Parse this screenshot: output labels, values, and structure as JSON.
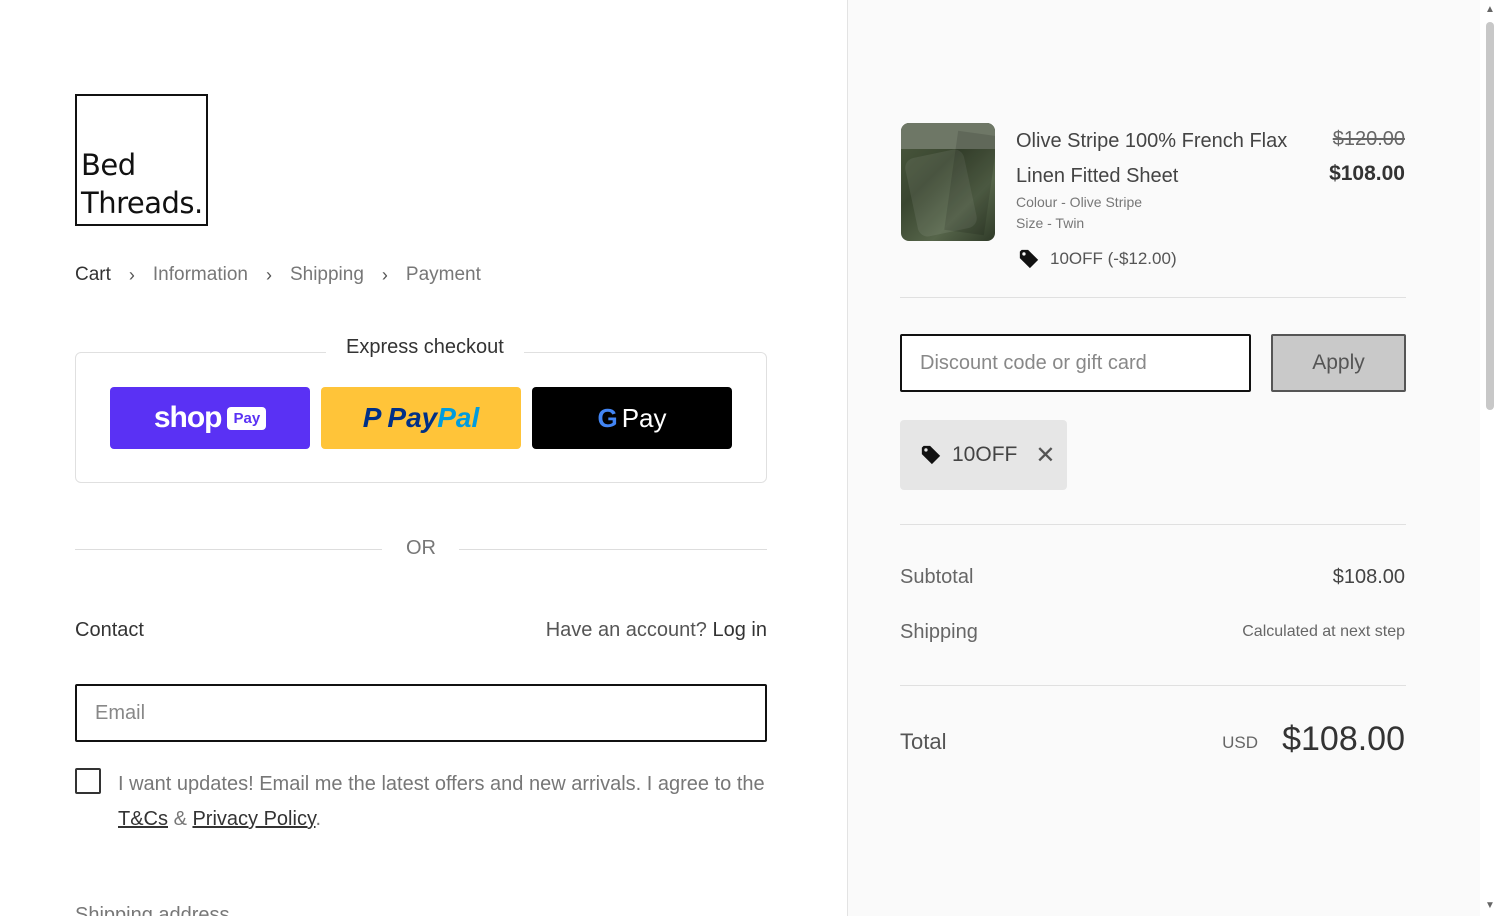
{
  "brand": {
    "line1": "Bed",
    "line2": "Threads."
  },
  "breadcrumb": [
    {
      "label": "Cart",
      "active": true
    },
    {
      "label": "Information",
      "active": false
    },
    {
      "label": "Shipping",
      "active": false
    },
    {
      "label": "Payment",
      "active": false
    }
  ],
  "express": {
    "title": "Express checkout",
    "shop_pay": {
      "word": "shop",
      "tag": "Pay"
    },
    "paypal": {
      "p": "P",
      "word1": "Pay",
      "word2": "Pal"
    },
    "gpay": {
      "g": "G",
      "word": "Pay"
    }
  },
  "divider": {
    "or": "OR"
  },
  "contact": {
    "label": "Contact",
    "account_prompt": "Have an account?",
    "login": "Log in",
    "email_placeholder": "Email",
    "consent_text": "I want updates! Email me the latest offers and new arrivals. I agree to the",
    "tcs": "T&Cs",
    "amp": "&",
    "privacy": "Privacy Policy",
    "period": "."
  },
  "next_section_peek": "Shipping address",
  "product": {
    "title": "Olive Stripe 100% French Flax Linen Fitted Sheet",
    "colour": "Colour - Olive Stripe",
    "size": "Size - Twin",
    "discount": "10OFF (-$12.00)",
    "old_price": "$120.00",
    "new_price": "$108.00"
  },
  "discount_form": {
    "placeholder": "Discount code or gift card",
    "apply": "Apply",
    "applied_code": "10OFF",
    "remove": "✕"
  },
  "summary": {
    "subtotal_label": "Subtotal",
    "subtotal_value": "$108.00",
    "shipping_label": "Shipping",
    "shipping_value": "Calculated at next step",
    "total_label": "Total",
    "currency": "USD",
    "total_value": "$108.00"
  },
  "colors": {
    "shop_pay": "#5a31f4",
    "paypal": "#ffc439",
    "gpay": "#000000"
  }
}
